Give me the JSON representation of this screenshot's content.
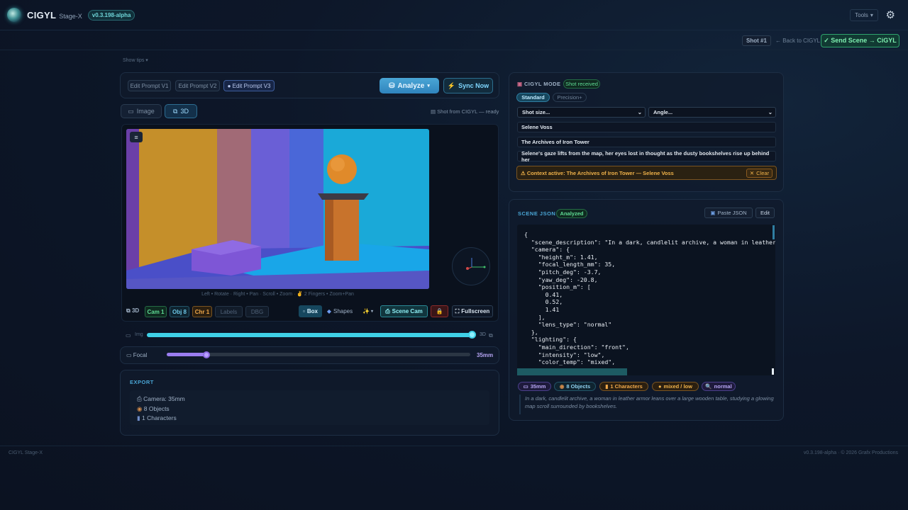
{
  "app": {
    "name": "CIGYL",
    "stage": "Stage-X",
    "version": "v0.3.198-alpha",
    "tools_label": "Tools"
  },
  "toolbar": {
    "shot_label": "Shot #1",
    "back_label": "← Back to CIGYL",
    "send_label": "✓ Send Scene → CiGYL"
  },
  "tips_label": "Show tips ▾",
  "prompts": {
    "versions": [
      "Edit Prompt V1",
      "Edit Prompt V2",
      "● Edit Prompt V3"
    ],
    "analyze_label": "Analyze",
    "sync_label": "Sync Now"
  },
  "view": {
    "image_tab": "Image",
    "threed_tab": "3D",
    "status": "Shot from CIGYL — ready"
  },
  "viewport": {
    "hint": "Left • Rotate · Right • Pan · Scroll • Zoom · ✌ 2 Fingers • Zoom+Pan"
  },
  "viewer_toolbar": {
    "mode_label": "3D",
    "toggles": [
      "Cam 1",
      "Obj 8",
      "Chr 1",
      "Labels",
      "DBG"
    ],
    "box_label": "Box",
    "shapes_label": "Shapes",
    "scene_cam_label": "Scene Cam",
    "fullscreen_label": "Fullscreen"
  },
  "mode_slider": {
    "left": "Img",
    "right": "3D",
    "value_fraction": 1.0
  },
  "focal": {
    "label": "Focal",
    "value": "35mm",
    "value_fraction": 0.13
  },
  "export": {
    "title": "EXPORT",
    "lines": [
      "Camera: 35mm",
      "8 Objects",
      "1 Characters"
    ]
  },
  "cigyl_panel": {
    "title": "CIGYL MODE",
    "badge": "Shot received",
    "tabs": [
      "Standard",
      "Precision+"
    ],
    "shot_size_placeholder": "Shot size...",
    "angle_placeholder": "Angle...",
    "fields": [
      "Selene Voss",
      "The Archives of Iron Tower",
      "Selene's gaze lifts from the map, her eyes lost in thought as the dusty bookshelves rise up behind her"
    ],
    "context": "Context active: The Archives of Iron Tower — Selene Voss",
    "clear_label": "Clear"
  },
  "scene_json": {
    "title": "SCENE JSON",
    "badge": "Analyzed",
    "paste_label": "Paste JSON",
    "edit_label": "Edit",
    "lines": [
      "{",
      "  \"scene_description\": \"In a dark, candlelit archive, a woman in leather",
      "  \"camera\": {",
      "    \"height_m\": 1.41,",
      "    \"focal_length_mm\": 35,",
      "    \"pitch_deg\": -3.7,",
      "    \"yaw_deg\": -20.8,",
      "    \"position_m\": [",
      "      0.41,",
      "      0.52,",
      "      1.41",
      "    ],",
      "    \"lens_type\": \"normal\"",
      "  },",
      "  \"lighting\": {",
      "    \"main_direction\": \"front\",",
      "    \"intensity\": \"low\",",
      "    \"color_temp\": \"mixed\","
    ],
    "tags": [
      "35mm",
      "8 Objects",
      "1 Characters",
      "mixed / low",
      "normal"
    ],
    "description": "In a dark, candlelit archive, a woman in leather armor leans over a large wooden table, studying a glowing map scroll surrounded by bookshelves."
  },
  "footer": {
    "left": "CIGYL Stage-X",
    "right": "v0.3.198-alpha · © 2026 Grafx Productions"
  },
  "colors": {
    "accent": "#2fa36d",
    "analyze": "#3b95c9",
    "focal": "#9a7df0",
    "mode": "#3fd0e6"
  }
}
